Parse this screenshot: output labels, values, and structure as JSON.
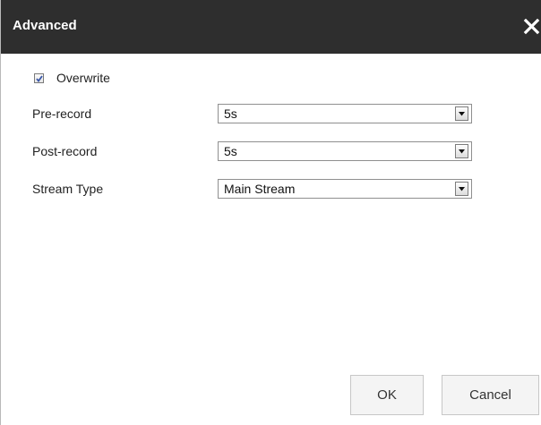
{
  "dialog": {
    "title": "Advanced",
    "close_icon": "close-icon"
  },
  "overwrite": {
    "label": "Overwrite",
    "checked": true
  },
  "fields": [
    {
      "label": "Pre-record",
      "value": "5s"
    },
    {
      "label": "Post-record",
      "value": "5s"
    },
    {
      "label": "Stream Type",
      "value": "Main Stream"
    }
  ],
  "buttons": {
    "ok": "OK",
    "cancel": "Cancel"
  },
  "colors": {
    "titlebar": "#2e2e2e",
    "title_text": "#ffffff",
    "button_bg": "#f4f4f4"
  }
}
